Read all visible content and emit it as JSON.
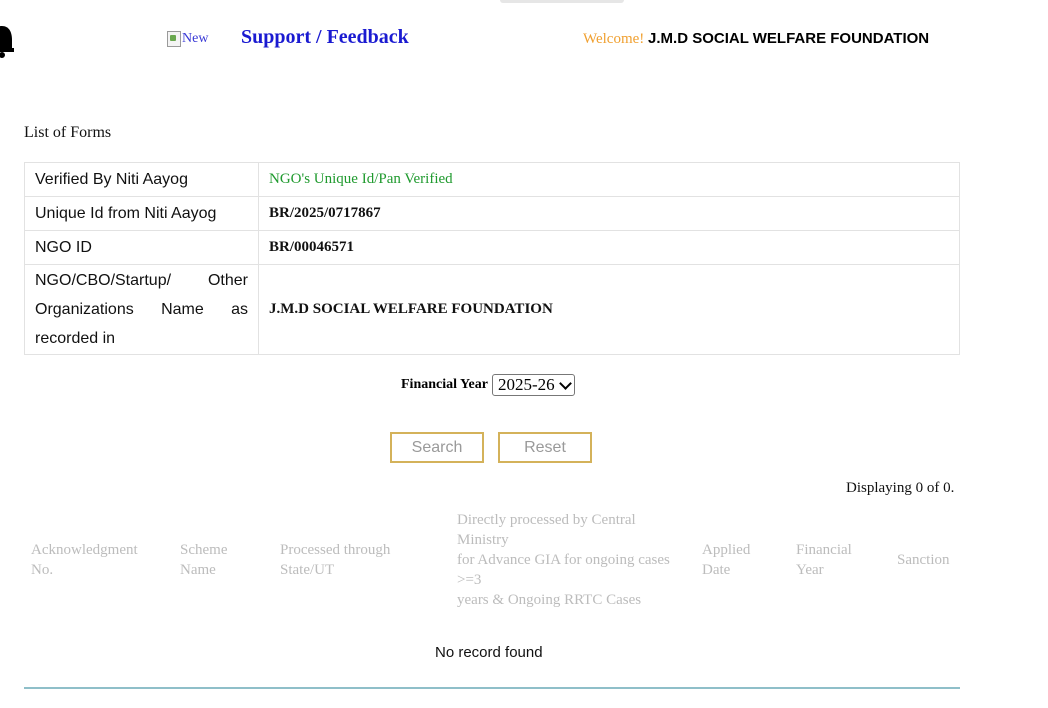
{
  "header": {
    "new_alt": "New",
    "support_link": "Support / Feedback",
    "welcome_prefix": "Welcome!",
    "org_name": "J.M.D SOCIAL WELFARE FOUNDATION"
  },
  "forms": {
    "title": "List of Forms",
    "rows": [
      {
        "label": "Verified By Niti Aayog",
        "value": "NGO's Unique Id/Pan Verified"
      },
      {
        "label": "Unique Id from Niti Aayog",
        "value": "BR/2025/0717867"
      },
      {
        "label": "NGO ID",
        "value": "BR/00046571"
      },
      {
        "label": "NGO/CBO/Startup/ Other Organizations Name as recorded in",
        "value": "J.M.D SOCIAL WELFARE FOUNDATION"
      }
    ]
  },
  "filters": {
    "fy_label": "Financial Year",
    "fy_selected": "2025-26",
    "search_label": "Search",
    "reset_label": "Reset"
  },
  "results": {
    "displaying": "Displaying 0 of 0.",
    "columns": [
      "Acknowledgment No.",
      "Scheme Name",
      "Processed through State/UT",
      "Directly processed by Central Ministry for Advance GIA for ongoing cases >=3 years & Ongoing RRTC Cases",
      "Applied Date",
      "Financial Year",
      "Sanction"
    ],
    "direct_lines": [
      "Directly processed by Central",
      "Ministry",
      "for Advance GIA for ongoing cases",
      ">=3",
      "years & Ongoing RRTC Cases"
    ],
    "empty_message": "No record found"
  },
  "colors": {
    "link": "#1a1ad1",
    "welcome": "#f0a030",
    "verified": "#1f9a2e",
    "button_border": "#d4b25a",
    "divider": "#8fbfc9"
  }
}
